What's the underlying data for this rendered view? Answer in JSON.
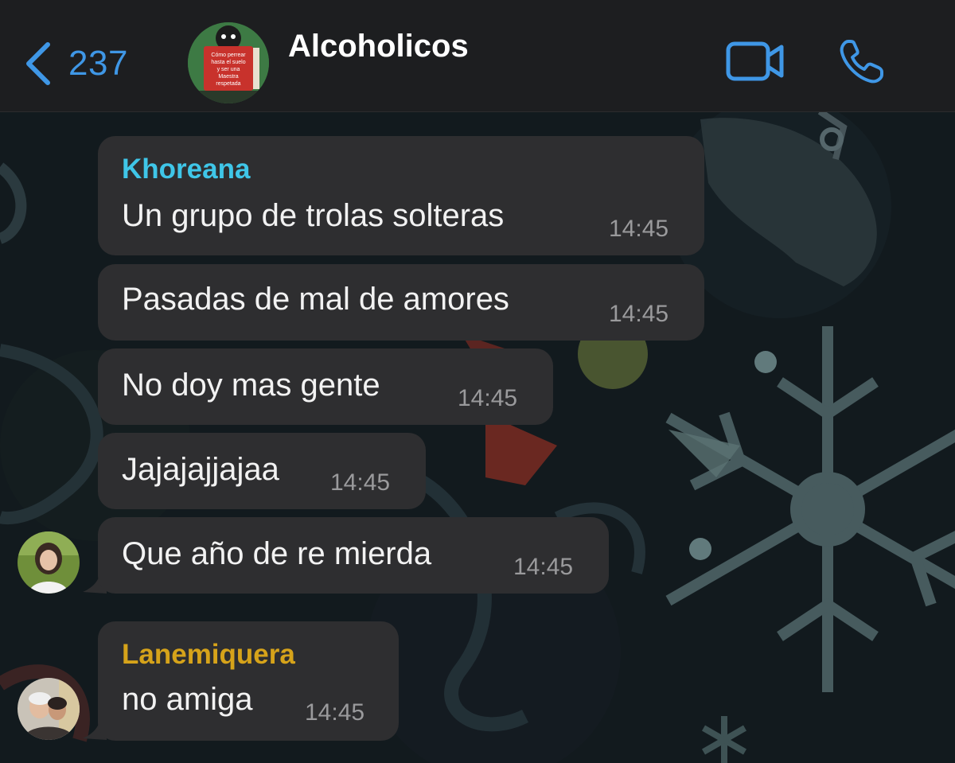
{
  "header": {
    "back_count": "237",
    "title": "Alcoholicos",
    "avatar_caption": [
      "Cómo perrear",
      "hasta el suelo",
      "y ser una",
      "Maestra",
      "respetada"
    ]
  },
  "messages": [
    {
      "sender": "Khoreana",
      "text": "Un grupo de trolas solteras",
      "time": "14:45"
    },
    {
      "text": "Pasadas de mal de amores",
      "time": "14:45"
    },
    {
      "text": "No doy mas gente",
      "time": "14:45"
    },
    {
      "text": "Jajajajjajaa",
      "time": "14:45"
    },
    {
      "text": "Que año de re mierda",
      "time": "14:45"
    },
    {
      "sender": "Lanemiquera",
      "text": "no amiga",
      "time": "14:45"
    }
  ],
  "colors": {
    "accent": "#3f97e6",
    "sender_khoreana": "#3fc6e8",
    "sender_lanemiquera": "#d6a31a",
    "bubble": "#2e2e30",
    "header": "#1d1e20"
  },
  "icons": {
    "back": "chevron-left-icon",
    "video": "video-camera-icon",
    "phone": "phone-icon"
  }
}
